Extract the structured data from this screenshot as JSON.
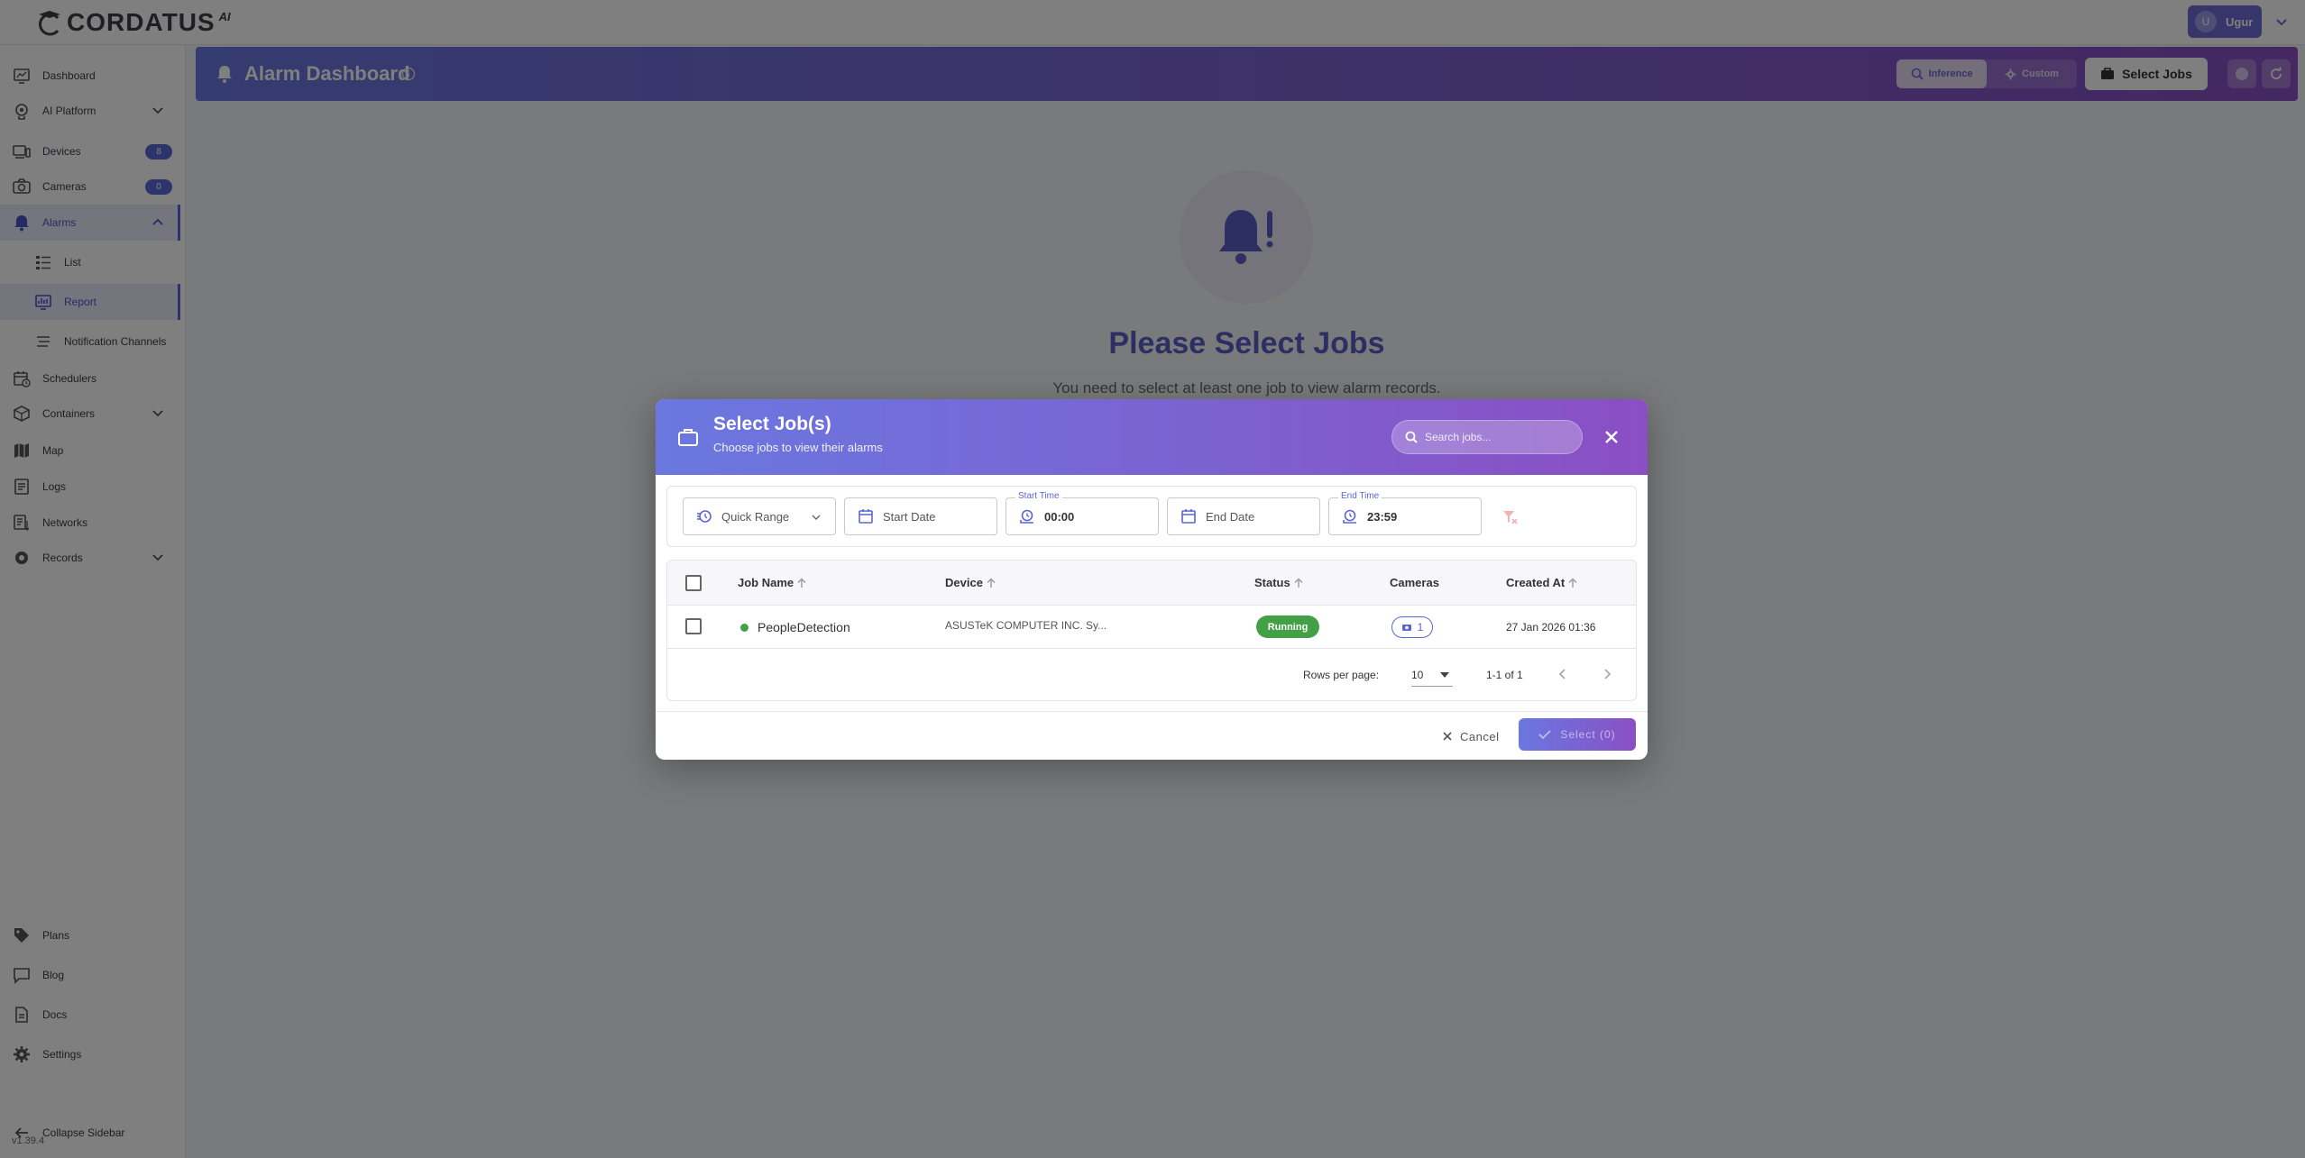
{
  "app": {
    "brand": "CORDATUS",
    "brand_sup": "AI",
    "user_initial": "U",
    "user_name": "Ugur",
    "version": "v1.39.4"
  },
  "sidebar": {
    "items": [
      {
        "label": "Dashboard",
        "icon": "dashboard-icon"
      },
      {
        "label": "AI Platform",
        "icon": "ai-platform-icon"
      },
      {
        "label": "Devices",
        "icon": "devices-icon",
        "badge": "8"
      },
      {
        "label": "Cameras",
        "icon": "camera-icon",
        "badge": "0"
      },
      {
        "label": "Alarms",
        "icon": "alarm-icon"
      },
      {
        "label": "List",
        "icon": "list-icon"
      },
      {
        "label": "Report",
        "icon": "report-icon"
      },
      {
        "label": "Notification Channels",
        "icon": "notification-channels-icon"
      },
      {
        "label": "Schedulers",
        "icon": "scheduler-icon"
      },
      {
        "label": "Containers",
        "icon": "containers-icon"
      },
      {
        "label": "Map",
        "icon": "map-icon"
      },
      {
        "label": "Logs",
        "icon": "logs-icon"
      },
      {
        "label": "Networks",
        "icon": "networks-icon"
      },
      {
        "label": "Records",
        "icon": "records-icon"
      }
    ],
    "bottom": [
      {
        "label": "Plans",
        "icon": "plans-icon"
      },
      {
        "label": "Blog",
        "icon": "blog-icon"
      },
      {
        "label": "Docs",
        "icon": "docs-icon"
      },
      {
        "label": "Settings",
        "icon": "settings-icon"
      }
    ],
    "collapse_label": "Collapse Sidebar"
  },
  "header": {
    "title": "Alarm Dashboard",
    "seg_inference": "Inference",
    "seg_custom": "Custom",
    "select_jobs_label": "Select Jobs"
  },
  "empty": {
    "title": "Please Select Jobs",
    "subtitle": "You need to select at least one job to view alarm records."
  },
  "dialog": {
    "title": "Select Job(s)",
    "subtitle": "Choose jobs to view their alarms",
    "search_placeholder": "Search jobs...",
    "filters": {
      "quick_range": "Quick Range",
      "start_date": "Start Date",
      "start_time_label": "Start Time",
      "start_time": "00:00",
      "end_date": "End Date",
      "end_time_label": "End Time",
      "end_time": "23:59"
    },
    "columns": [
      "Job Name",
      "Device",
      "Status",
      "Cameras",
      "Created At"
    ],
    "rows": [
      {
        "job_name": "PeopleDetection",
        "device": "ASUSTeK COMPUTER INC. Sy...",
        "status": "Running",
        "cameras": "1",
        "created_at": "27 Jan 2026 01:36"
      }
    ],
    "pagination": {
      "rows_per_page_label": "Rows per page:",
      "rows_per_page": "10",
      "range": "1-1 of 1"
    },
    "cancel_label": "Cancel",
    "select_label": "Select (0)"
  },
  "colors": {
    "accent": "#5b66d6",
    "header_gradient_start": "#6a78e0",
    "header_gradient_end": "#8a4fc4",
    "running": "#43a047"
  }
}
